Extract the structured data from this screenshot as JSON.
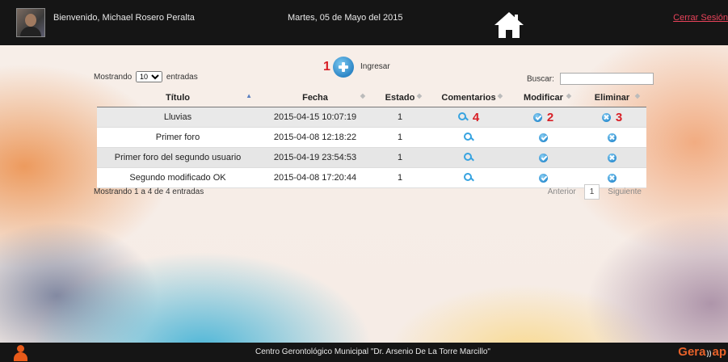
{
  "header": {
    "welcome": "Bienvenido, Michael Rosero Peralta",
    "date": "Martes, 05 de Mayo del 2015",
    "logout": "Cerrar Sesión"
  },
  "toolbar": {
    "add_number": "1",
    "add_label": "Ingresar",
    "length_prefix": "Mostrando",
    "length_value": "10",
    "length_suffix": "entradas",
    "search_label": "Buscar:",
    "search_value": ""
  },
  "table": {
    "columns": [
      "Título",
      "Fecha",
      "Estado",
      "Comentarios",
      "Modificar",
      "Eliminar"
    ],
    "rows": [
      {
        "titulo": "Lluvias",
        "fecha": "2015-04-15 10:07:19",
        "estado": "1",
        "ann_comment": "4",
        "ann_edit": "2",
        "ann_delete": "3"
      },
      {
        "titulo": "Primer foro",
        "fecha": "2015-04-08 12:18:22",
        "estado": "1"
      },
      {
        "titulo": "Primer foro del segundo usuario",
        "fecha": "2015-04-19 23:54:53",
        "estado": "1"
      },
      {
        "titulo": "Segundo modificado OK",
        "fecha": "2015-04-08 17:20:44",
        "estado": "1"
      }
    ]
  },
  "footer_table": {
    "info": "Mostrando 1 a 4 de 4 entradas",
    "prev": "Anterior",
    "page": "1",
    "next": "Siguiente"
  },
  "footer": {
    "text": "Centro Gerontológico Municipal \"Dr. Arsenio De La Torre Marcillo\"",
    "logo_left": "Gera",
    "logo_right": "ap"
  },
  "colors": {
    "accent": "#2d8ed0",
    "annotation": "#d81f26",
    "logout": "#e8435a",
    "bar": "#151515"
  }
}
